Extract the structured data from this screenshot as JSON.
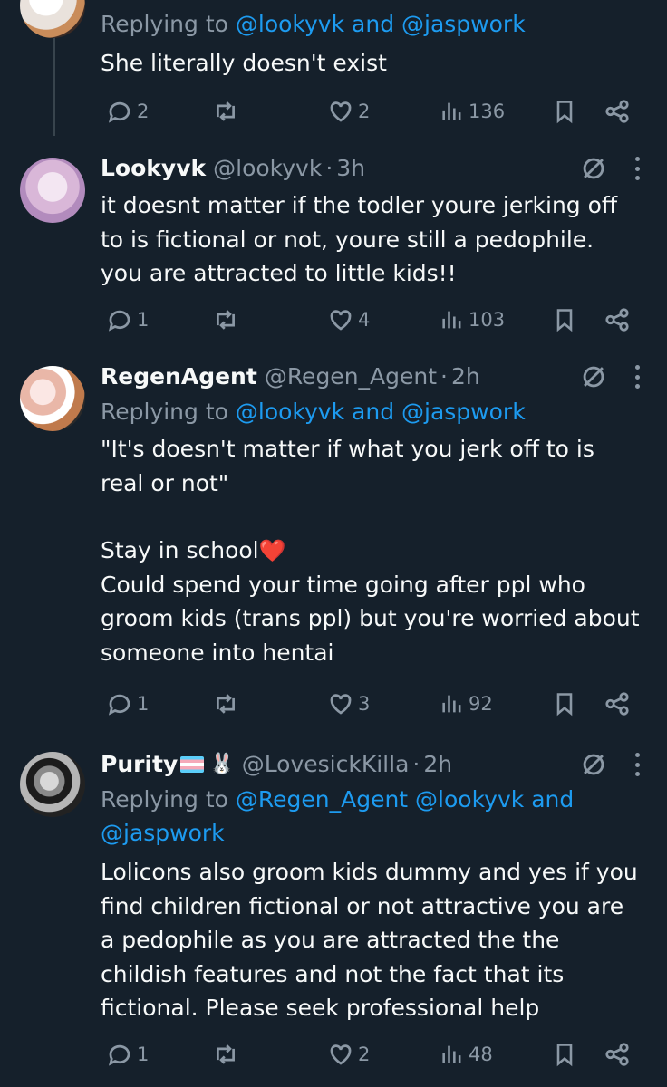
{
  "tweets": [
    {
      "reply_prefix": "Replying to ",
      "reply_mentions": "@lookyvk and @jaspwork",
      "text": "She literally doesn't exist",
      "replies": "2",
      "retweets": "",
      "likes": "2",
      "views": "136"
    },
    {
      "name": "Lookyvk",
      "handle": "@lookyvk",
      "time": "3h",
      "text": "it doesnt matter if the todler youre jerking off to is fictional or not, youre still a pedophile. you are attracted to little kids!!",
      "replies": "1",
      "retweets": "",
      "likes": "4",
      "views": "103"
    },
    {
      "name": "RegenAgent",
      "handle": "@Regen_Agent",
      "time": "2h",
      "reply_prefix": "Replying to ",
      "reply_mentions": "@lookyvk and @jaspwork",
      "text_a": "\"It's doesn't matter if what you jerk off to is real or not\"",
      "text_b": "Stay in school",
      "text_c": "Could spend your time going after ppl who groom kids (trans ppl) but you're worried about someone into hentai",
      "replies": "1",
      "retweets": "",
      "likes": "3",
      "views": "92"
    },
    {
      "name": "Purity",
      "handle": "@LovesickKilla",
      "time": "2h",
      "reply_prefix": "Replying to ",
      "reply_mentions": "@Regen_Agent @lookyvk and @jaspwork",
      "text": "Lolicons also groom kids dummy and yes if you find children fictional or not attractive you are a pedophile as you are attracted the the childish features and not the fact that its fictional. Please seek professional help",
      "replies": "1",
      "retweets": "",
      "likes": "2",
      "views": "48"
    }
  ],
  "dot": "·",
  "emoji_heart": "❤️",
  "emoji_bunny": "🐰",
  "colors": {
    "background": "#15202b",
    "text": "#f7f9f9",
    "muted": "#8b98a5",
    "link": "#1d9bf0"
  }
}
